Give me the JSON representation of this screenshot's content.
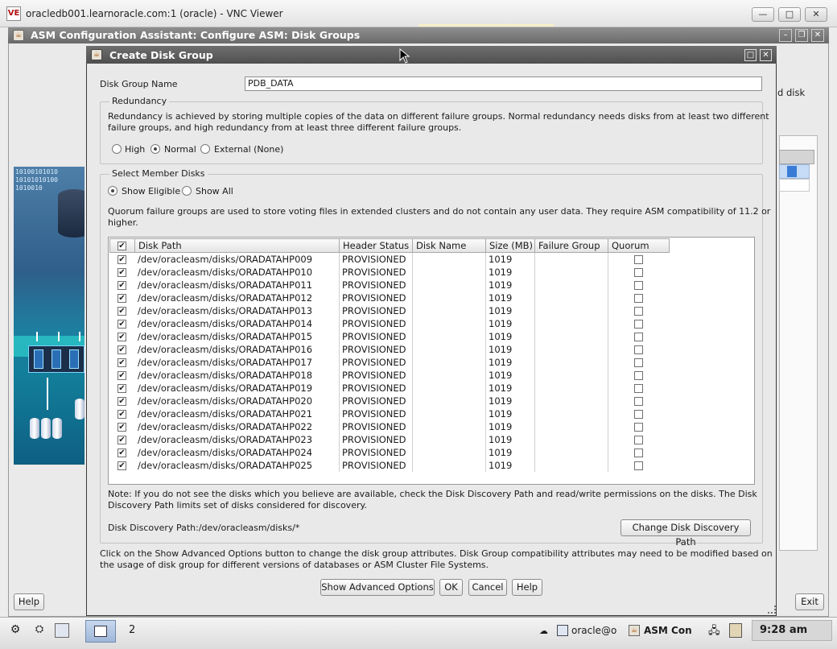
{
  "vnc": {
    "title": "oracledb001.learnoracle.com:1 (oracle) - VNC Viewer",
    "icon_text": "VE",
    "minimize": "—",
    "maximize": "□",
    "close": "✕"
  },
  "asm_window": {
    "title": "ASM Configuration Assistant: Configure ASM: Disk Groups",
    "right_partial_text": "d disk",
    "help_label": "Help",
    "exit_label": "Exit",
    "art_binary": "10100101010\n10101010100\n1010010"
  },
  "dialog": {
    "title": "Create Disk Group",
    "disk_group_name_label": "Disk Group Name",
    "disk_group_name_value": "PDB_DATA",
    "redundancy": {
      "legend": "Redundancy",
      "description_line1": "Redundancy is achieved by storing multiple copies of the data on different failure groups. Normal redundancy needs disks from at least two different",
      "description_line2": "failure groups, and high redundancy from at least three different failure groups.",
      "options": [
        "High",
        "Normal",
        "External (None)"
      ],
      "selected": "Normal"
    },
    "member_disks": {
      "legend": "Select Member Disks",
      "filter_options": [
        "Show Eligible",
        "Show All"
      ],
      "selected_filter": "Show Eligible",
      "quorum_note_line1": "Quorum failure groups are used to store voting files in extended clusters and do not contain any user data. They require ASM compatibility of 11.2 or",
      "quorum_note_line2": "higher.",
      "columns": [
        "",
        "Disk Path",
        "Header Status",
        "Disk Name",
        "Size (MB)",
        "Failure Group",
        "Quorum"
      ],
      "rows": [
        {
          "path": "/dev/oracleasm/disks/ORADATAHP009",
          "status": "PROVISIONED",
          "name": "",
          "size": "1019",
          "failure_group": "",
          "selected": true,
          "quorum": false
        },
        {
          "path": "/dev/oracleasm/disks/ORADATAHP010",
          "status": "PROVISIONED",
          "name": "",
          "size": "1019",
          "failure_group": "",
          "selected": true,
          "quorum": false
        },
        {
          "path": "/dev/oracleasm/disks/ORADATAHP011",
          "status": "PROVISIONED",
          "name": "",
          "size": "1019",
          "failure_group": "",
          "selected": true,
          "quorum": false
        },
        {
          "path": "/dev/oracleasm/disks/ORADATAHP012",
          "status": "PROVISIONED",
          "name": "",
          "size": "1019",
          "failure_group": "",
          "selected": true,
          "quorum": false
        },
        {
          "path": "/dev/oracleasm/disks/ORADATAHP013",
          "status": "PROVISIONED",
          "name": "",
          "size": "1019",
          "failure_group": "",
          "selected": true,
          "quorum": false
        },
        {
          "path": "/dev/oracleasm/disks/ORADATAHP014",
          "status": "PROVISIONED",
          "name": "",
          "size": "1019",
          "failure_group": "",
          "selected": true,
          "quorum": false
        },
        {
          "path": "/dev/oracleasm/disks/ORADATAHP015",
          "status": "PROVISIONED",
          "name": "",
          "size": "1019",
          "failure_group": "",
          "selected": true,
          "quorum": false
        },
        {
          "path": "/dev/oracleasm/disks/ORADATAHP016",
          "status": "PROVISIONED",
          "name": "",
          "size": "1019",
          "failure_group": "",
          "selected": true,
          "quorum": false
        },
        {
          "path": "/dev/oracleasm/disks/ORADATAHP017",
          "status": "PROVISIONED",
          "name": "",
          "size": "1019",
          "failure_group": "",
          "selected": true,
          "quorum": false
        },
        {
          "path": "/dev/oracleasm/disks/ORADATAHP018",
          "status": "PROVISIONED",
          "name": "",
          "size": "1019",
          "failure_group": "",
          "selected": true,
          "quorum": false
        },
        {
          "path": "/dev/oracleasm/disks/ORADATAHP019",
          "status": "PROVISIONED",
          "name": "",
          "size": "1019",
          "failure_group": "",
          "selected": true,
          "quorum": false
        },
        {
          "path": "/dev/oracleasm/disks/ORADATAHP020",
          "status": "PROVISIONED",
          "name": "",
          "size": "1019",
          "failure_group": "",
          "selected": true,
          "quorum": false
        },
        {
          "path": "/dev/oracleasm/disks/ORADATAHP021",
          "status": "PROVISIONED",
          "name": "",
          "size": "1019",
          "failure_group": "",
          "selected": true,
          "quorum": false
        },
        {
          "path": "/dev/oracleasm/disks/ORADATAHP022",
          "status": "PROVISIONED",
          "name": "",
          "size": "1019",
          "failure_group": "",
          "selected": true,
          "quorum": false
        },
        {
          "path": "/dev/oracleasm/disks/ORADATAHP023",
          "status": "PROVISIONED",
          "name": "",
          "size": "1019",
          "failure_group": "",
          "selected": true,
          "quorum": false
        },
        {
          "path": "/dev/oracleasm/disks/ORADATAHP024",
          "status": "PROVISIONED",
          "name": "",
          "size": "1019",
          "failure_group": "",
          "selected": true,
          "quorum": false
        },
        {
          "path": "/dev/oracleasm/disks/ORADATAHP025",
          "status": "PROVISIONED",
          "name": "",
          "size": "1019",
          "failure_group": "",
          "selected": true,
          "quorum": false
        }
      ],
      "discovery_note_line1": "Note: If you do not see the disks which you believe are available, check the Disk Discovery Path and read/write permissions on the disks. The Disk",
      "discovery_note_line2": "Discovery Path limits set of disks considered for discovery.",
      "discovery_path_label": "Disk Discovery Path:/dev/oracleasm/disks/*",
      "change_path_button": "Change Disk Discovery Path"
    },
    "advanced_note_line1": "Click on the Show Advanced Options button to change the disk group attributes. Disk Group compatibility attributes may need to be modified based on",
    "advanced_note_line2": "the usage of disk group for different versions of databases or ASM Cluster File Systems.",
    "buttons": {
      "advanced": "Show Advanced Options",
      "ok": "OK",
      "cancel": "Cancel",
      "help": "Help"
    }
  },
  "taskbar": {
    "workspace_2": "2",
    "task_terminal": "oracle@o",
    "task_asm": "ASM Con",
    "clock": "9:28 am"
  }
}
